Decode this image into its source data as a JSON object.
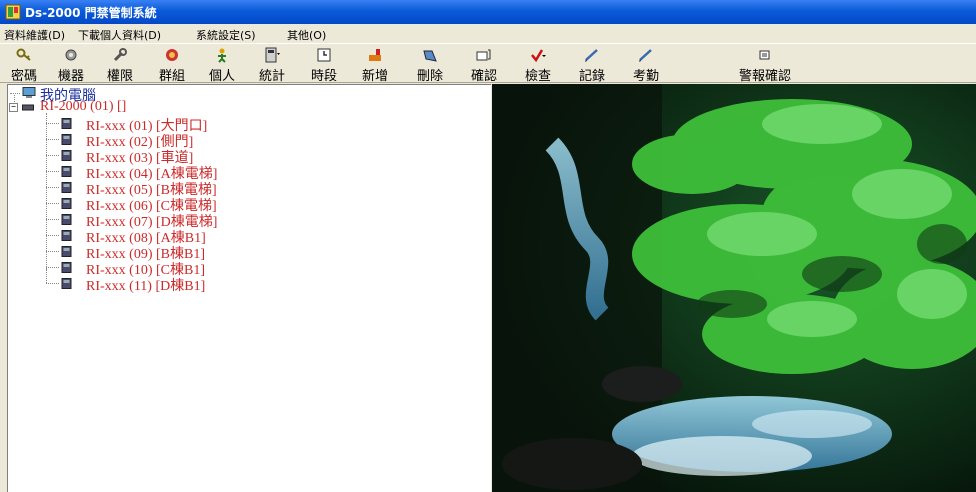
{
  "window": {
    "title": "Ds-2000 門禁管制系統",
    "app_icon": "app-icon"
  },
  "menu": [
    {
      "label": "資料維護(D)"
    },
    {
      "label": "下載個人資料(D)"
    },
    {
      "label": "系統設定(S)"
    },
    {
      "label": "其他(O)"
    }
  ],
  "toolbar": [
    {
      "label": "密碼",
      "icon": "key-icon"
    },
    {
      "label": "機器",
      "icon": "gear-icon"
    },
    {
      "label": "權限",
      "icon": "wrench-icon"
    },
    {
      "label": "群組",
      "icon": "group-icon"
    },
    {
      "label": "個人",
      "icon": "person-icon"
    },
    {
      "label": "統計",
      "icon": "calculator-icon"
    },
    {
      "label": "時段",
      "icon": "clock-icon"
    },
    {
      "label": "新增",
      "icon": "add-icon"
    },
    {
      "label": "刪除",
      "icon": "delete-icon"
    },
    {
      "label": "確認",
      "icon": "confirm-icon"
    },
    {
      "label": "檢查",
      "icon": "check-icon"
    },
    {
      "label": "記錄",
      "icon": "log-icon"
    },
    {
      "label": "考勤",
      "icon": "attendance-icon"
    },
    {
      "label": "警報確認",
      "icon": "alarm-icon"
    }
  ],
  "tree": {
    "root": {
      "label": "我的電腦",
      "icon": "computer-icon"
    },
    "controller": {
      "label": "RI-2000 (01) []",
      "expander": "−"
    },
    "devices": [
      {
        "label": "RI-xxx (01) [大門口]"
      },
      {
        "label": "RI-xxx (02) [側門]"
      },
      {
        "label": "RI-xxx (03) [車道]"
      },
      {
        "label": "RI-xxx (04) [A棟電梯]"
      },
      {
        "label": "RI-xxx (05) [B棟電梯]"
      },
      {
        "label": "RI-xxx (06) [C棟電梯]"
      },
      {
        "label": "RI-xxx (07) [D棟電梯]"
      },
      {
        "label": "RI-xxx (08) [A棟B1]"
      },
      {
        "label": "RI-xxx (09) [B棟B1]"
      },
      {
        "label": "RI-xxx (10) [C棟B1]"
      },
      {
        "label": "RI-xxx (11) [D棟B1]"
      }
    ]
  },
  "colors": {
    "titlebar": "#0a5bd9",
    "device_text": "#cc2a2a",
    "root_text": "#1a2f9c"
  }
}
